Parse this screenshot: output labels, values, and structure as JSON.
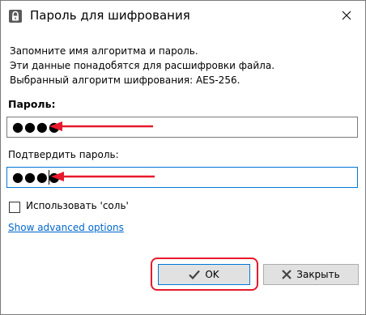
{
  "window": {
    "title": "Пароль для шифрования"
  },
  "info": {
    "line1": "Запомните имя алгоритма и пароль.",
    "line2": "Эти данные понадобятся для расшифровки файла.",
    "line3": "Выбранный алгоритм шифрования: AES-256."
  },
  "password": {
    "label": "Пароль:",
    "value": "●●●●"
  },
  "confirm": {
    "label": "Подтвердить пароль:",
    "value": "●●●●"
  },
  "salt": {
    "label": "Использовать 'соль'",
    "checked": false
  },
  "advanced_link": "Show advanced options",
  "buttons": {
    "ok": "OK",
    "close": "Закрыть"
  },
  "colors": {
    "annotation": "#e8192c",
    "focus": "#0078d7",
    "link": "#0066cc"
  }
}
